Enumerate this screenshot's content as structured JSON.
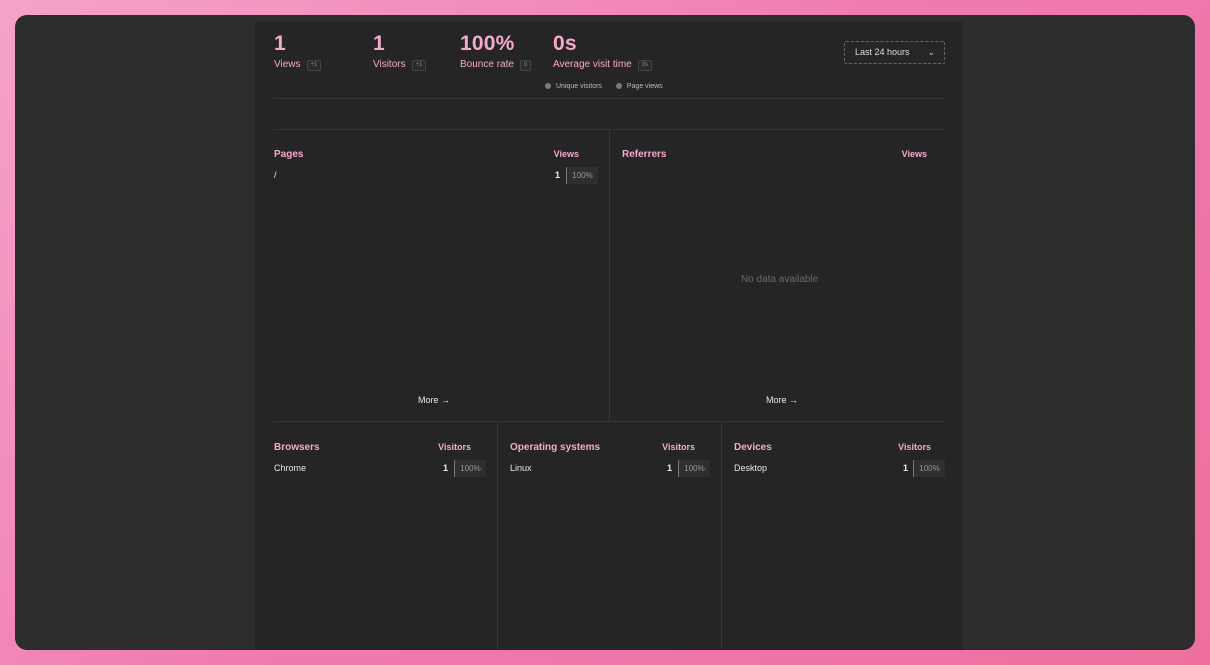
{
  "metrics": [
    {
      "value": "1",
      "label": "Views",
      "change": "+1"
    },
    {
      "value": "1",
      "label": "Visitors",
      "change": "+1"
    },
    {
      "value": "100%",
      "label": "Bounce rate",
      "change": "0"
    },
    {
      "value": "0s",
      "label": "Average visit time",
      "change": "0s"
    }
  ],
  "date_range": {
    "label": "Last 24 hours"
  },
  "legend": [
    {
      "label": "Unique visitors"
    },
    {
      "label": "Page views"
    }
  ],
  "pages": {
    "title": "Pages",
    "column": "Views",
    "rows": [
      {
        "label": "/",
        "value": "1",
        "percent": "100%"
      }
    ],
    "more": "More"
  },
  "referrers": {
    "title": "Referrers",
    "column": "Views",
    "empty": "No data available",
    "more": "More"
  },
  "browsers": {
    "title": "Browsers",
    "column": "Visitors",
    "rows": [
      {
        "label": "Chrome",
        "value": "1",
        "percent": "100%"
      }
    ]
  },
  "os": {
    "title": "Operating systems",
    "column": "Visitors",
    "rows": [
      {
        "label": "Linux",
        "value": "1",
        "percent": "100%"
      }
    ]
  },
  "devices": {
    "title": "Devices",
    "column": "Visitors",
    "rows": [
      {
        "label": "Desktop",
        "value": "1",
        "percent": "100%"
      }
    ]
  },
  "colors": {
    "accent": "#f6a9cf",
    "panel": "#252525",
    "window": "#2d2d2d"
  }
}
